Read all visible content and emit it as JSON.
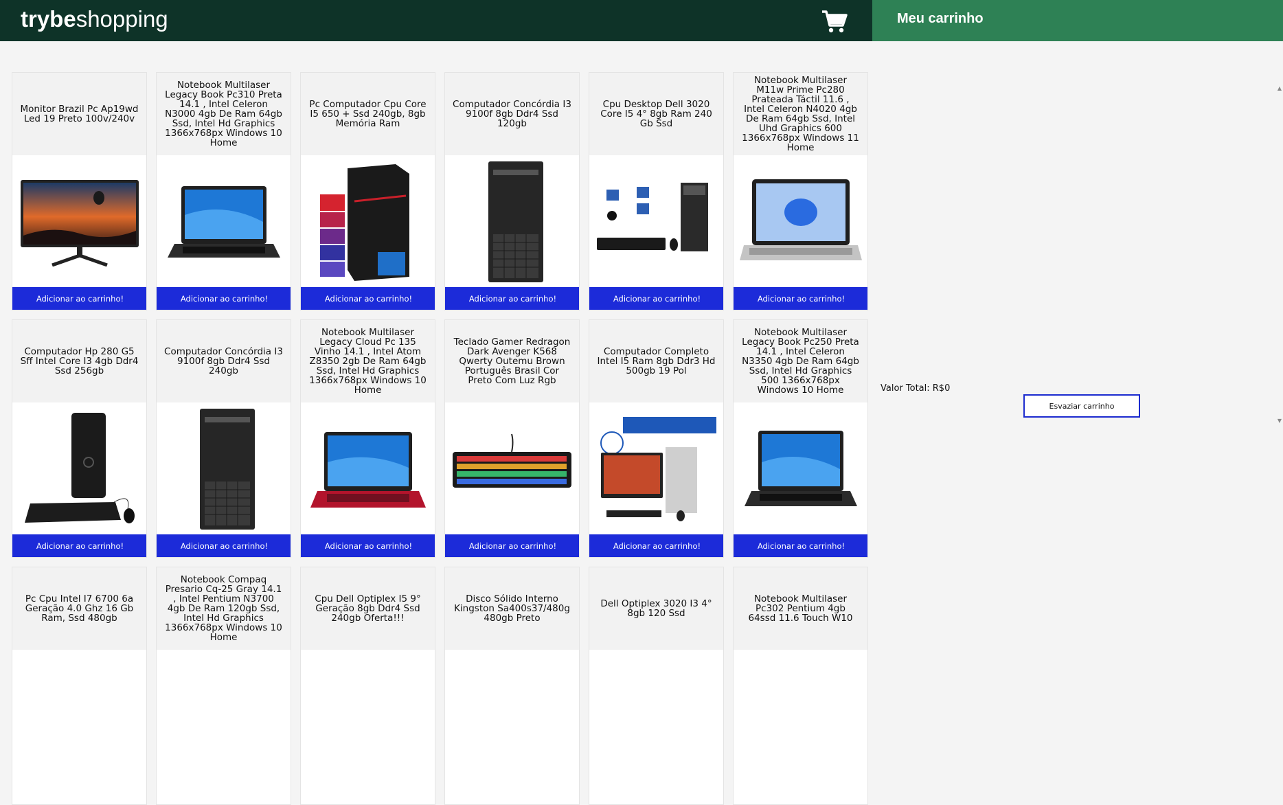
{
  "header": {
    "brand_bold": "trybe",
    "brand_light": "shopping",
    "cart_icon": "shopping-cart-icon"
  },
  "cart": {
    "title": "Meu carrinho",
    "total_label": "Valor Total: R$0",
    "empty_button": "Esvaziar carrinho"
  },
  "colors": {
    "header_bg": "#0e3328",
    "cart_header_bg": "#2e8155",
    "button_blue": "#1c2bd9"
  },
  "products": [
    {
      "title": "Monitor Brazil Pc Ap19wd Led 19  Preto 100v/240v",
      "image": "monitor",
      "button": "Adicionar ao carrinho!"
    },
    {
      "title": "Notebook Multilaser Legacy Book Pc310 Preta 14.1 , Intel Celeron N3000 4gb De Ram 64gb Ssd, Intel Hd Graphics 1366x768px Windows 10 Home",
      "image": "laptop-black",
      "button": "Adicionar ao carrinho!"
    },
    {
      "title": "Pc Computador Cpu Core I5 650 + Ssd 240gb, 8gb Memória Ram",
      "image": "pc-tower-red",
      "button": "Adicionar ao carrinho!"
    },
    {
      "title": "Computador Concórdia I3 9100f 8gb Ddr4 Ssd 120gb",
      "image": "tower-dark",
      "button": "Adicionar ao carrinho!"
    },
    {
      "title": "Cpu Desktop Dell 3020 Core I5 4° 8gb Ram 240 Gb Ssd",
      "image": "desktop-kit",
      "button": "Adicionar ao carrinho!"
    },
    {
      "title": "Notebook Multilaser M11w Prime Pc280 Prateada Táctil 11.6 , Intel Celeron N4020 4gb De Ram 64gb Ssd, Intel Uhd Graphics 600 1366x768px Windows 11 Home",
      "image": "laptop-silver",
      "button": "Adicionar ao carrinho!"
    },
    {
      "title": "Computador Hp 280 G5 Sff Intel Core I3 4gb Ddr4 Ssd 256gb",
      "image": "hp-desktop",
      "button": "Adicionar ao carrinho!"
    },
    {
      "title": "Computador Concórdia I3 9100f 8gb Ddr4 Ssd 240gb",
      "image": "tower-dark",
      "button": "Adicionar ao carrinho!"
    },
    {
      "title": "Notebook Multilaser Legacy Cloud Pc 135 Vinho 14.1 , Intel Atom Z8350 2gb De Ram 64gb Ssd, Intel Hd Graphics 1366x768px Windows 10 Home",
      "image": "laptop-red",
      "button": "Adicionar ao carrinho!"
    },
    {
      "title": "Teclado Gamer Redragon Dark Avenger K568 Qwerty Outemu Brown Português Brasil Cor Preto Com Luz Rgb",
      "image": "keyboard",
      "button": "Adicionar ao carrinho!"
    },
    {
      "title": "Computador Completo Intel I5 Ram 8gb Ddr3 Hd 500gb 19 Pol",
      "image": "complete-pc",
      "button": "Adicionar ao carrinho!"
    },
    {
      "title": "Notebook Multilaser Legacy Book Pc250 Preta 14.1 , Intel Celeron N3350 4gb De Ram 64gb Ssd, Intel Hd Graphics 500 1366x768px Windows 10 Home",
      "image": "laptop-black",
      "button": "Adicionar ao carrinho!"
    },
    {
      "title": "Pc Cpu Intel I7 6700 6a Geração 4.0 Ghz 16 Gb Ram, Ssd 480gb",
      "image": "none",
      "button": ""
    },
    {
      "title": "Notebook Compaq Presario Cq-25 Gray 14.1 , Intel Pentium N3700 4gb De Ram 120gb Ssd, Intel Hd Graphics 1366x768px Windows 10 Home",
      "image": "none",
      "button": ""
    },
    {
      "title": "Cpu Dell Optiplex I5 9° Geração 8gb Ddr4 Ssd 240gb Oferta!!!",
      "image": "none",
      "button": ""
    },
    {
      "title": "Disco Sólido Interno Kingston Sa400s37/480g 480gb Preto",
      "image": "none",
      "button": ""
    },
    {
      "title": "Dell Optiplex 3020 I3 4° 8gb 120 Ssd",
      "image": "none",
      "button": ""
    },
    {
      "title": "Notebook Multilaser Pc302 Pentium 4gb 64ssd 11.6 Touch W10",
      "image": "none",
      "button": ""
    }
  ]
}
